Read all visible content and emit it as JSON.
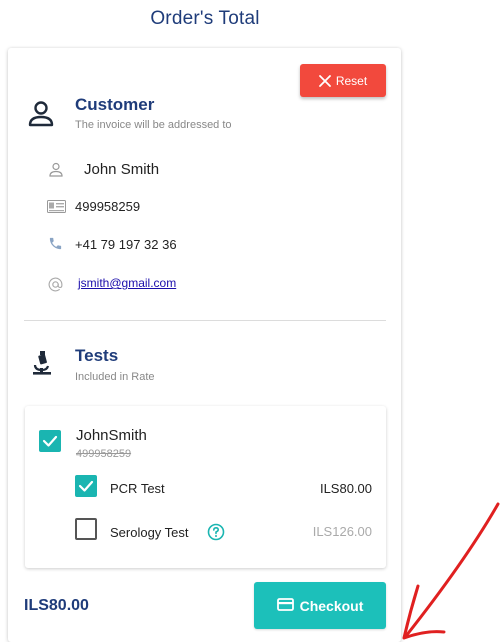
{
  "header": {
    "title": "Order's Total"
  },
  "reset": {
    "label": "Reset"
  },
  "customer": {
    "title": "Customer",
    "subtitle": "The invoice will be addressed to",
    "name": "John Smith",
    "id_number": "499958259",
    "phone": "+41 79 197 32 36",
    "email": "jsmith@gmail.com"
  },
  "tests": {
    "title": "Tests",
    "subtitle": "Included in Rate",
    "patient": {
      "name": "JohnSmith",
      "id_number": "499958259",
      "checked": true
    },
    "items": [
      {
        "label": "PCR Test",
        "price": "ILS80.00",
        "checked": true
      },
      {
        "label": "Serology Test",
        "price": "ILS126.00",
        "checked": false,
        "has_help_icon": true
      }
    ]
  },
  "footer": {
    "total": "ILS80.00",
    "checkout_label": "Checkout"
  },
  "colors": {
    "primary_text": "#1f3c7a",
    "reset": "#f2493d",
    "checkout": "#1cc0ba",
    "checkbox": "#1ab5b1",
    "annotation_arrow": "#e02020"
  },
  "icons": {
    "reset": "close-icon",
    "customer": "person-icon",
    "name": "person-outline-icon",
    "id": "id-card-icon",
    "phone": "phone-icon",
    "email": "at-icon",
    "tests": "microscope-icon",
    "help": "help-circle-icon",
    "checkout": "credit-card-icon"
  }
}
